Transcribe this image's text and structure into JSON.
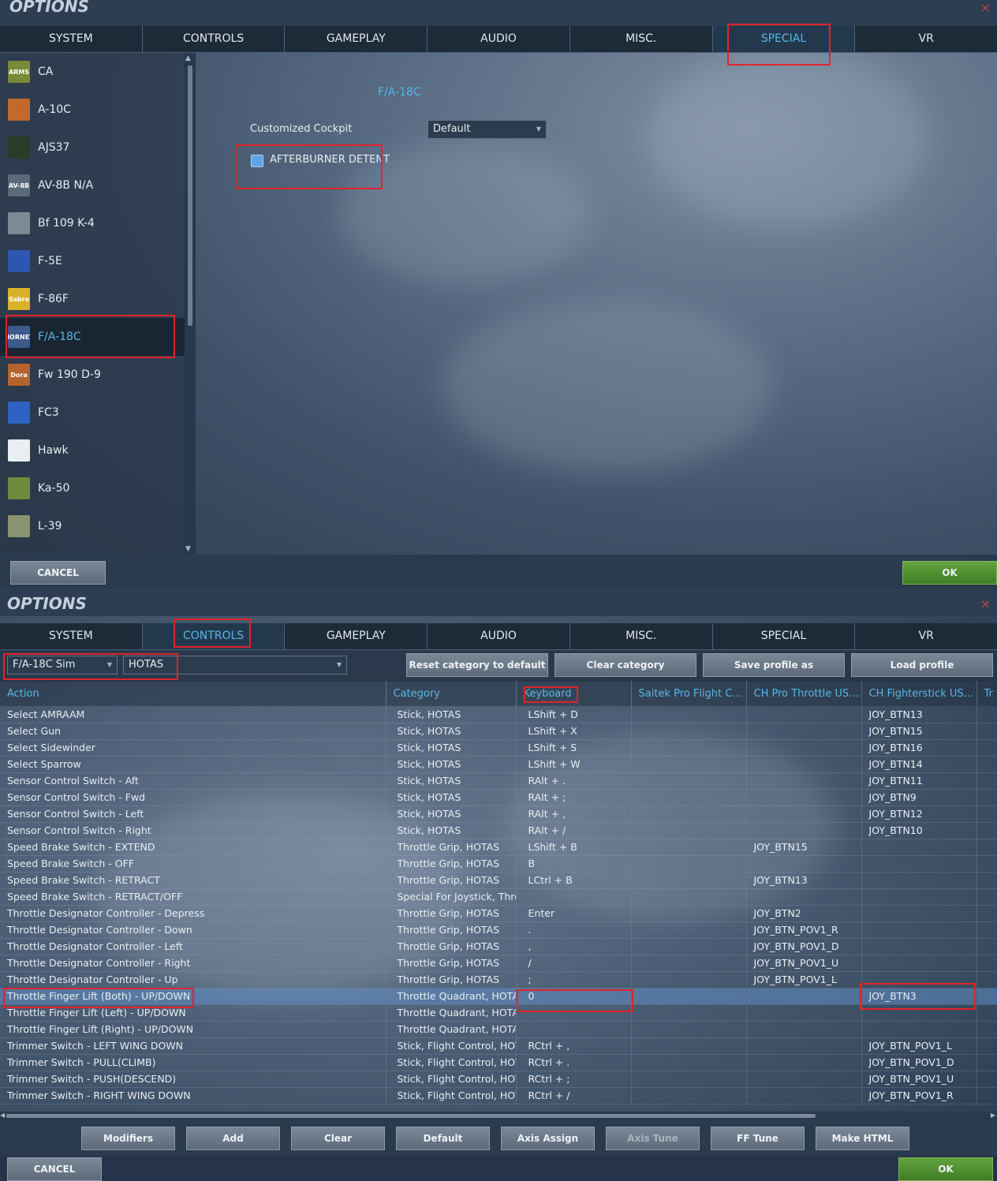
{
  "top": {
    "title": "OPTIONS",
    "close_icon": "×",
    "tabs": [
      "SYSTEM",
      "CONTROLS",
      "GAMEPLAY",
      "AUDIO",
      "MISC.",
      "SPECIAL",
      "VR"
    ],
    "active_tab": "SPECIAL",
    "aircraft": [
      {
        "label": "CA",
        "icon": "ca-icon",
        "color": "#7a8a3a",
        "short": "ARMS"
      },
      {
        "label": "A-10C",
        "icon": "a10c-icon",
        "color": "#c2682b",
        "short": ""
      },
      {
        "label": "AJS37",
        "icon": "ajs37-icon",
        "color": "#2a3b2a",
        "short": ""
      },
      {
        "label": "AV-8B N/A",
        "icon": "av8b-icon",
        "color": "#5a6a78",
        "short": "AV-8B"
      },
      {
        "label": "Bf 109 K-4",
        "icon": "bf109-icon",
        "color": "#7d8a93",
        "short": ""
      },
      {
        "label": "F-5E",
        "icon": "f5e-icon",
        "color": "#2e56b0",
        "short": ""
      },
      {
        "label": "F-86F",
        "icon": "f86f-icon",
        "color": "#d8b32a",
        "short": "Sabre"
      },
      {
        "label": "F/A-18C",
        "icon": "fa18c-icon",
        "color": "#3c5a8c",
        "short": "HORNET"
      },
      {
        "label": "Fw 190 D-9",
        "icon": "fw190-icon",
        "color": "#b4632c",
        "short": "Dora"
      },
      {
        "label": "FC3",
        "icon": "fc3-icon",
        "color": "#2e63c3",
        "short": ""
      },
      {
        "label": "Hawk",
        "icon": "hawk-icon",
        "color": "#e9eef3",
        "short": ""
      },
      {
        "label": "Ka-50",
        "icon": "ka50-icon",
        "color": "#6e8a3c",
        "short": ""
      },
      {
        "label": "L-39",
        "icon": "l39-icon",
        "color": "#8a9270",
        "short": ""
      }
    ],
    "selected_aircraft": "F/A-18C",
    "special": {
      "heading": "F/A-18C",
      "cockpit_label": "Customized Cockpit",
      "cockpit_value": "Default",
      "afterburner_label": "AFTERBURNER DETENT"
    },
    "cancel_label": "CANCEL",
    "ok_label": "OK"
  },
  "bottom": {
    "title": "OPTIONS",
    "close_icon": "×",
    "tabs": [
      "SYSTEM",
      "CONTROLS",
      "GAMEPLAY",
      "AUDIO",
      "MISC.",
      "SPECIAL",
      "VR"
    ],
    "active_tab": "CONTROLS",
    "profile_select": "F/A-18C Sim",
    "category_select": "HOTAS",
    "toolbar": {
      "reset": "Reset category to default",
      "clear": "Clear category",
      "save": "Save profile as",
      "load": "Load profile"
    },
    "columns": [
      "Action",
      "Category",
      "Keyboard",
      "Saitek Pro Flight Co...",
      "CH Pro Throttle USB...",
      "CH Fighterstick USB...",
      "Tr"
    ],
    "rows": [
      [
        "Select AMRAAM",
        "Stick, HOTAS",
        "LShift + D",
        "",
        "",
        "JOY_BTN13"
      ],
      [
        "Select Gun",
        "Stick, HOTAS",
        "LShift + X",
        "",
        "",
        "JOY_BTN15"
      ],
      [
        "Select Sidewinder",
        "Stick, HOTAS",
        "LShift + S",
        "",
        "",
        "JOY_BTN16"
      ],
      [
        "Select Sparrow",
        "Stick, HOTAS",
        "LShift + W",
        "",
        "",
        "JOY_BTN14"
      ],
      [
        "Sensor Control Switch - Aft",
        "Stick, HOTAS",
        "RAlt + .",
        "",
        "",
        "JOY_BTN11"
      ],
      [
        "Sensor Control Switch - Fwd",
        "Stick, HOTAS",
        "RAlt + ;",
        "",
        "",
        "JOY_BTN9"
      ],
      [
        "Sensor Control Switch - Left",
        "Stick, HOTAS",
        "RAlt + ,",
        "",
        "",
        "JOY_BTN12"
      ],
      [
        "Sensor Control Switch - Right",
        "Stick, HOTAS",
        "RAlt + /",
        "",
        "",
        "JOY_BTN10"
      ],
      [
        "Speed Brake Switch - EXTEND",
        "Throttle Grip, HOTAS",
        "LShift + B",
        "",
        "JOY_BTN15",
        ""
      ],
      [
        "Speed Brake Switch - OFF",
        "Throttle Grip, HOTAS",
        "B",
        "",
        "",
        ""
      ],
      [
        "Speed Brake Switch - RETRACT",
        "Throttle Grip, HOTAS",
        "LCtrl + B",
        "",
        "JOY_BTN13",
        ""
      ],
      [
        "Speed Brake Switch - RETRACT/OFF",
        "Special For Joystick, Throt",
        "",
        "",
        "",
        ""
      ],
      [
        "Throttle Designator Controller - Depress",
        "Throttle Grip, HOTAS",
        "Enter",
        "",
        "JOY_BTN2",
        ""
      ],
      [
        "Throttle Designator Controller - Down",
        "Throttle Grip, HOTAS",
        ".",
        "",
        "JOY_BTN_POV1_R",
        ""
      ],
      [
        "Throttle Designator Controller - Left",
        "Throttle Grip, HOTAS",
        ",",
        "",
        "JOY_BTN_POV1_D",
        ""
      ],
      [
        "Throttle Designator Controller - Right",
        "Throttle Grip, HOTAS",
        "/",
        "",
        "JOY_BTN_POV1_U",
        ""
      ],
      [
        "Throttle Designator Controller - Up",
        "Throttle Grip, HOTAS",
        ";",
        "",
        "JOY_BTN_POV1_L",
        ""
      ],
      [
        "Throttle Finger Lift (Both) - UP/DOWN",
        "Throttle Quadrant, HOTAS",
        "0",
        "",
        "",
        "JOY_BTN3"
      ],
      [
        "Throttle Finger Lift (Left) - UP/DOWN",
        "Throttle Quadrant, HOTAS",
        "",
        "",
        "",
        ""
      ],
      [
        "Throttle Finger Lift (Right) - UP/DOWN",
        "Throttle Quadrant, HOTAS",
        "",
        "",
        "",
        ""
      ],
      [
        "Trimmer Switch - LEFT WING DOWN",
        "Stick, Flight Control, HOTA",
        "RCtrl + ,",
        "",
        "",
        "JOY_BTN_POV1_L"
      ],
      [
        "Trimmer Switch - PULL(CLIMB)",
        "Stick, Flight Control, HOTA",
        "RCtrl + .",
        "",
        "",
        "JOY_BTN_POV1_D"
      ],
      [
        "Trimmer Switch - PUSH(DESCEND)",
        "Stick, Flight Control, HOTA",
        "RCtrl + ;",
        "",
        "",
        "JOY_BTN_POV1_U"
      ],
      [
        "Trimmer Switch - RIGHT WING DOWN",
        "Stick, Flight Control, HOTA",
        "RCtrl + /",
        "",
        "",
        "JOY_BTN_POV1_R"
      ]
    ],
    "selected_row": 17,
    "actions": [
      "Modifiers",
      "Add",
      "Clear",
      "Default",
      "Axis Assign",
      "Axis Tune",
      "FF Tune",
      "Make HTML"
    ],
    "cancel_label": "CANCEL",
    "ok_label": "OK"
  }
}
